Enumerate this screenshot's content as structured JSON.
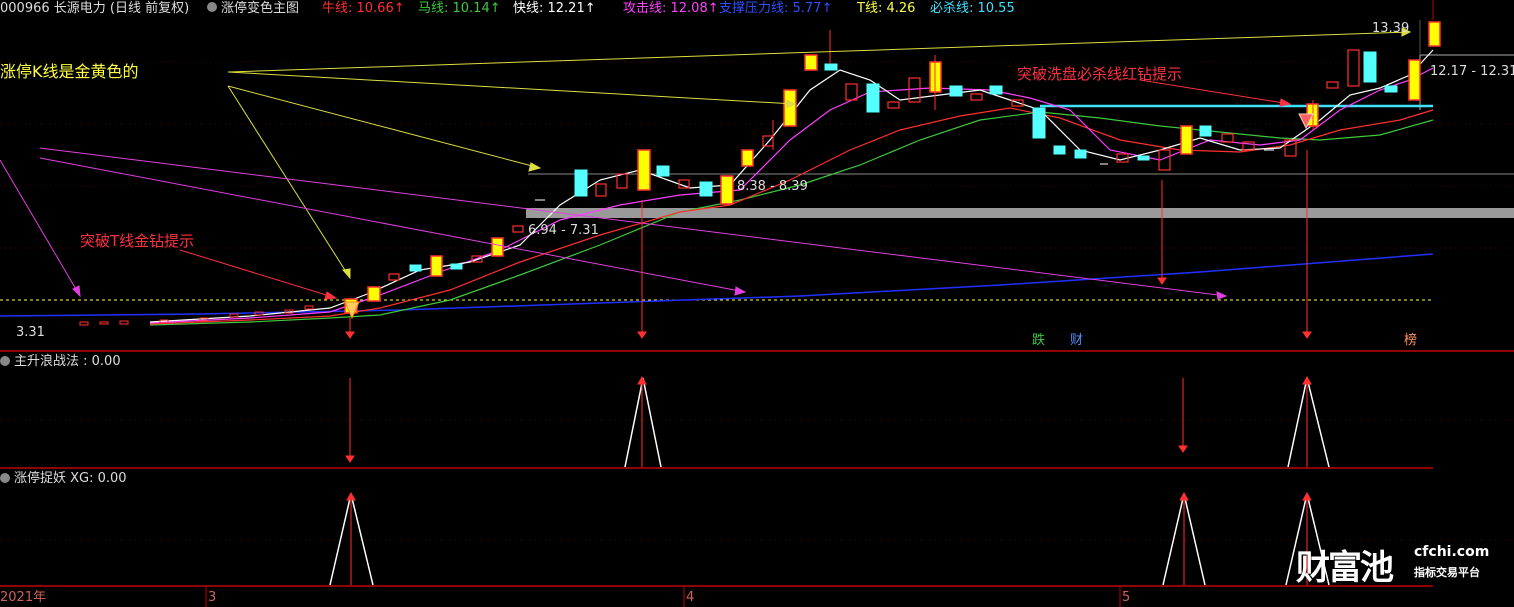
{
  "header": {
    "stock_code_name": "000966 长源电力 (日线 前复权)",
    "indicator_name": "涨停变色主图",
    "lines": [
      {
        "label": "牛线: 10.66↑",
        "color": "#ff3030"
      },
      {
        "label": "马线: 10.14↑",
        "color": "#3ec93e"
      },
      {
        "label": "快线: 12.21↑",
        "color": "#ffffff"
      },
      {
        "label": "攻击线: 12.08↑",
        "color": "#ff40ff"
      },
      {
        "label": "支撑压力线: 5.77↑",
        "color": "#3050ff"
      },
      {
        "label": "T线: 4.26",
        "color": "#ffff40"
      },
      {
        "label": "必杀线: 10.55",
        "color": "#40e0ff"
      }
    ]
  },
  "annotations": {
    "limit_up_note": "涨停K线是金黄色的",
    "t_line_note": "突破T线金钻提示",
    "kill_line_note": "突破洗盘必杀线红钻提示",
    "range_1": "6.94 - 7.31",
    "range_2": "8.38 - 8.39",
    "range_3": "12.17 - 12.31",
    "high_price": "13.39",
    "low_price": "3.31"
  },
  "markers": {
    "die": "跌",
    "cai": "财",
    "bang": "榜"
  },
  "panels": {
    "panel2_title": "主升浪战法 : 0.00",
    "panel3_title": "涨停捉妖 XG: 0.00"
  },
  "timeline": {
    "labels": [
      "2021年",
      "3",
      "4",
      "5"
    ]
  },
  "watermark": {
    "brand": "财富池",
    "url": "cfchi.com",
    "subtitle": "指标交易平台"
  },
  "colors": {
    "background": "#000000",
    "limit_up_candle": "#ffff00",
    "up_candle": "#ff3030",
    "down_candle": "#55ffff",
    "panel_border": "#c00000"
  }
}
